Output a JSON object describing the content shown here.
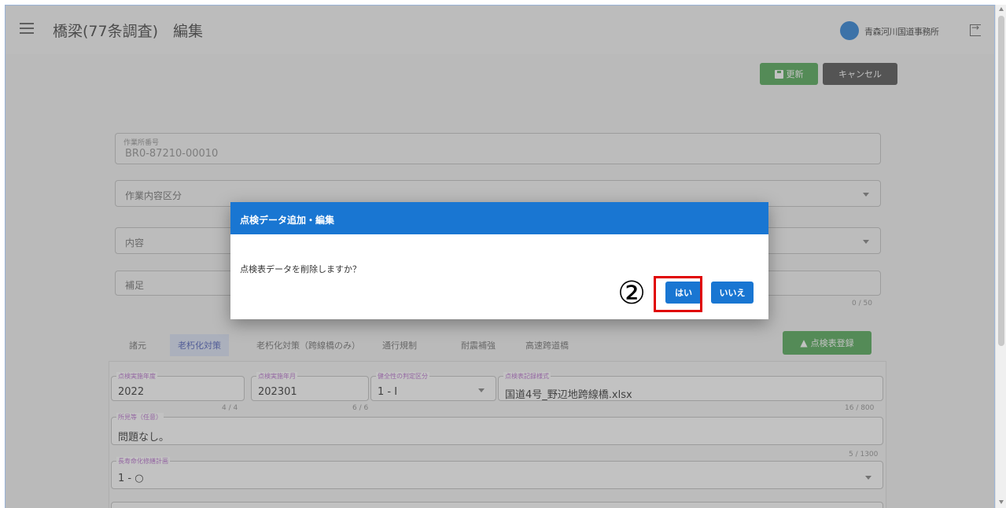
{
  "header": {
    "title": "橋梁(77条調査)　編集",
    "office_name": "青森河川国道事務所"
  },
  "toolbar": {
    "update_label": "更新",
    "cancel_label": "キャンセル"
  },
  "form": {
    "record_number_label": "作業所番号",
    "record_number_value": "BR0-87210-00010",
    "work_category_placeholder": "作業内容区分",
    "content_placeholder": "内容",
    "supplement_placeholder": "補足",
    "supplement_counter": "0 / 50"
  },
  "tabs": [
    {
      "label": "諸元"
    },
    {
      "label": "老朽化対策"
    },
    {
      "label": "老朽化対策（跨線橋のみ）"
    },
    {
      "label": "通行規制"
    },
    {
      "label": "耐震補強"
    },
    {
      "label": "高速跨道橋"
    }
  ],
  "register_button_label": "点検表登録",
  "inspection": {
    "year_label": "点検実施年度",
    "year_value": "2022",
    "year_counter": "4 / 4",
    "month_label": "点検実施年月",
    "month_value": "202301",
    "month_counter": "6 / 6",
    "judgement_label": "健全性の判定区分",
    "judgement_value": "1 - Ⅰ",
    "form_label": "点検表記録様式",
    "form_value": "国道4号_野辺地跨線橋.xlsx",
    "form_counter": "16 / 800",
    "remarks_label": "所見等（任意）",
    "remarks_value": "問題なし。",
    "remarks_counter": "5 / 1300",
    "plan_label": "長寿命化修繕計画",
    "plan_value": "1 - ○"
  },
  "dialog": {
    "title": "点検データ追加・編集",
    "message": "点検表データを削除しますか？",
    "yes_label": "はい",
    "no_label": "いいえ"
  },
  "annotation": {
    "step_marker": "②",
    "highlight_color": "#e00000"
  },
  "colors": {
    "primary": "#1976d2",
    "success": "#43a047",
    "dark": "#424242"
  }
}
